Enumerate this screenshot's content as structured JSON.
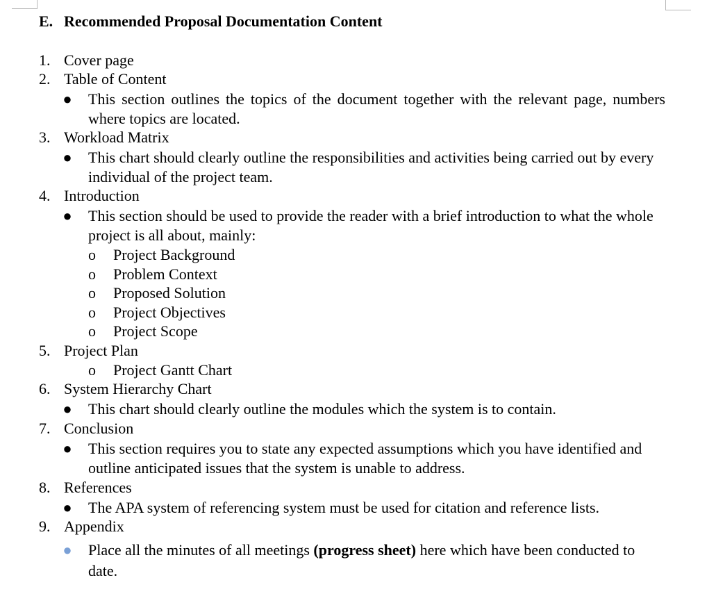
{
  "heading": {
    "number": "E.",
    "title": "Recommended Proposal Documentation Content"
  },
  "items": [
    {
      "number": "1.",
      "label": "Cover page"
    },
    {
      "number": "2.",
      "label": "Table of Content",
      "bullet": "This section outlines the topics of the document together with the relevant page, numbers where topics are located."
    },
    {
      "number": "3.",
      "label": "Workload Matrix",
      "bullet": "This chart should clearly outline the responsibilities and activities being carried out by every individual of the project team."
    },
    {
      "number": "4.",
      "label": "Introduction",
      "bullet": "This section should be used to provide the reader with a brief introduction to what the whole project is all about, mainly:",
      "subitems": [
        "Project Background",
        "Problem Context",
        "Proposed Solution",
        "Project Objectives",
        "Project Scope"
      ]
    },
    {
      "number": "5.",
      "label": "Project Plan",
      "subitems": [
        "Project Gantt Chart"
      ]
    },
    {
      "number": "6.",
      "label": "System Hierarchy Chart",
      "bullet": "This chart should clearly outline the modules which the system is to contain."
    },
    {
      "number": "7.",
      "label": "Conclusion",
      "bullet": "This section requires you to state any expected assumptions which you have identified and outline anticipated issues that the system is unable to address."
    },
    {
      "number": "8.",
      "label": "References",
      "bullet": "The APA system of referencing system must be used for citation and reference lists."
    },
    {
      "number": "9.",
      "label": "Appendix",
      "bullet_parts": {
        "before": "Place all the minutes of all meetings",
        "bold": " (progress sheet)",
        "after": " here which have been conducted to date."
      }
    }
  ],
  "glyphs": {
    "bullet": "●",
    "sub_bullet": "o"
  },
  "colors": {
    "appendix_bullet": "#7aa0d6",
    "crop_marks": "#b7b7b7"
  }
}
